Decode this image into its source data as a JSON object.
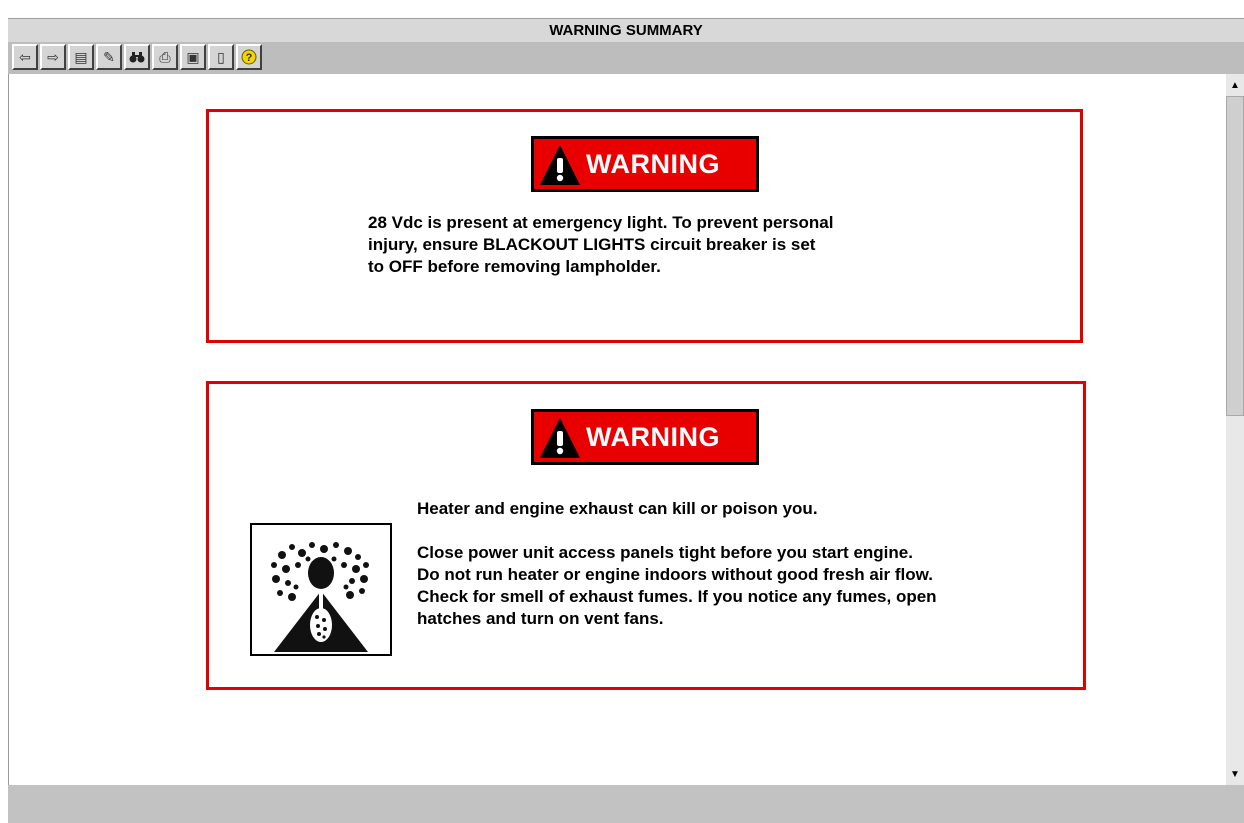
{
  "window": {
    "title": "WARNING SUMMARY"
  },
  "toolbar": {
    "buttons": [
      {
        "name": "back-arrow-icon",
        "glyph": "⇦"
      },
      {
        "name": "forward-arrow-icon",
        "glyph": "⇨"
      },
      {
        "name": "toc-index-icon",
        "glyph": "▤"
      },
      {
        "name": "pencil-icon",
        "glyph": "✎"
      },
      {
        "name": "binoculars-icon",
        "glyph": "👁"
      },
      {
        "name": "print-icon",
        "glyph": "⎙"
      },
      {
        "name": "bookmark-icon",
        "glyph": "▣"
      },
      {
        "name": "exit-door-icon",
        "glyph": "▯"
      },
      {
        "name": "help-icon",
        "glyph": "?"
      }
    ]
  },
  "warnings": [
    {
      "badge": "WARNING",
      "paragraphs": [
        "28 Vdc is present at emergency light. To prevent personal injury, ensure BLACKOUT LIGHTS circuit breaker is set to OFF before removing lampholder."
      ],
      "lines": [
        "28 Vdc is present at emergency light. To prevent personal",
        "injury, ensure BLACKOUT LIGHTS circuit breaker is set",
        "to OFF before removing lampholder."
      ]
    },
    {
      "badge": "WARNING",
      "lines_p1": [
        "Heater and engine exhaust can kill or poison you."
      ],
      "lines_p2": [
        "Close power unit access panels tight before you start engine.",
        "Do not run heater or engine indoors without good fresh air flow.",
        "Check for smell of exhaust fumes. If you notice any fumes, open",
        "hatches and turn on vent fans."
      ]
    }
  ],
  "colors": {
    "warning_red": "#e00000",
    "badge_red": "#e80000"
  }
}
